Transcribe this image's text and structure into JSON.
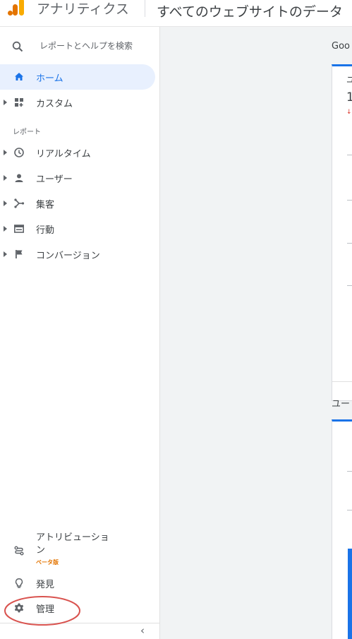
{
  "app": {
    "title": "アナリティクス",
    "account_title": "すべてのウェブサイトのデータ",
    "logo_colors": [
      "#f9ab00",
      "#e37400",
      "#e37400"
    ]
  },
  "sidebar": {
    "search_label": "レポートとヘルプを検索",
    "reports_header": "レポート",
    "items": [
      {
        "label": "ホーム",
        "icon": "home-icon"
      },
      {
        "label": "カスタム",
        "icon": "dashboard-icon"
      },
      {
        "label": "リアルタイム",
        "icon": "clock-icon"
      },
      {
        "label": "ユーザー",
        "icon": "person-icon"
      },
      {
        "label": "集客",
        "icon": "acquisition-icon"
      },
      {
        "label": "行動",
        "icon": "behavior-icon"
      },
      {
        "label": "コンバージョン",
        "icon": "flag-icon"
      }
    ],
    "bottom_items": [
      {
        "label": "アトリビューション",
        "badge": "ベータ版",
        "icon": "attribution-icon"
      },
      {
        "label": "発見",
        "icon": "lightbulb-icon"
      },
      {
        "label": "管理",
        "icon": "gear-icon"
      }
    ],
    "collapse_glyph": "‹"
  },
  "main": {
    "heading": "Goo",
    "section2_heading": "ユー",
    "card1_lines": [
      "ユ",
      "1",
      "↓"
    ],
    "accent_color": "#1a73e8",
    "highlight_circle_color": "#d9534f"
  }
}
